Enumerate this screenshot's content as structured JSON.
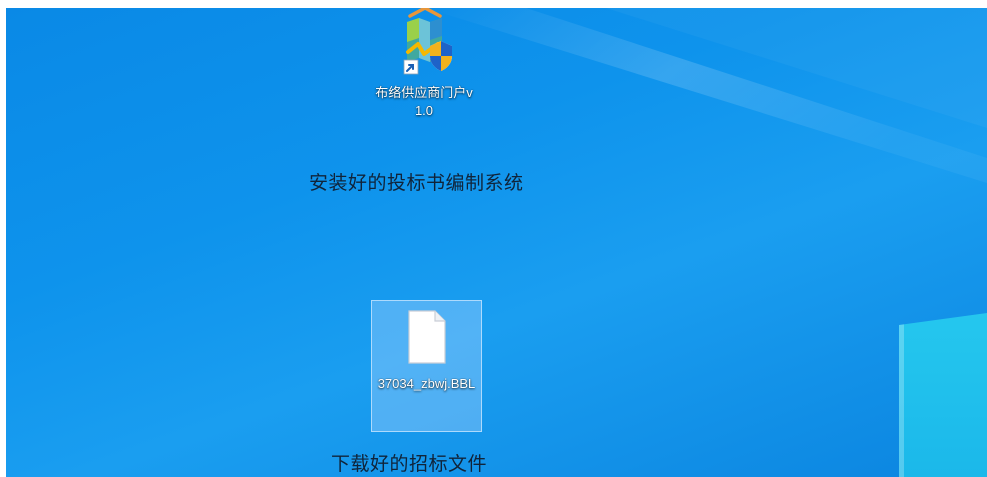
{
  "desktop": {
    "icons": [
      {
        "name": "布络供应商门户v1.0",
        "label": "布络供应商门户v1.0",
        "type": "shortcut"
      },
      {
        "name": "37034_zbwj.BBL",
        "label": "37034_zbwj.BBL",
        "type": "file",
        "selected": true
      }
    ],
    "annotations": {
      "system_note": "安装好的投标书编制系统",
      "file_note": "下载好的招标文件"
    }
  },
  "colors": {
    "wallpaper": "#0e93ec",
    "selection": "#add6ff",
    "annotation_text": "#10243a",
    "window_edge": "#25c7ee"
  },
  "icon_names": {
    "portal": "portal-app-icon",
    "shortcut_overlay": "shortcut-arrow-icon",
    "file": "blank-document-icon"
  }
}
